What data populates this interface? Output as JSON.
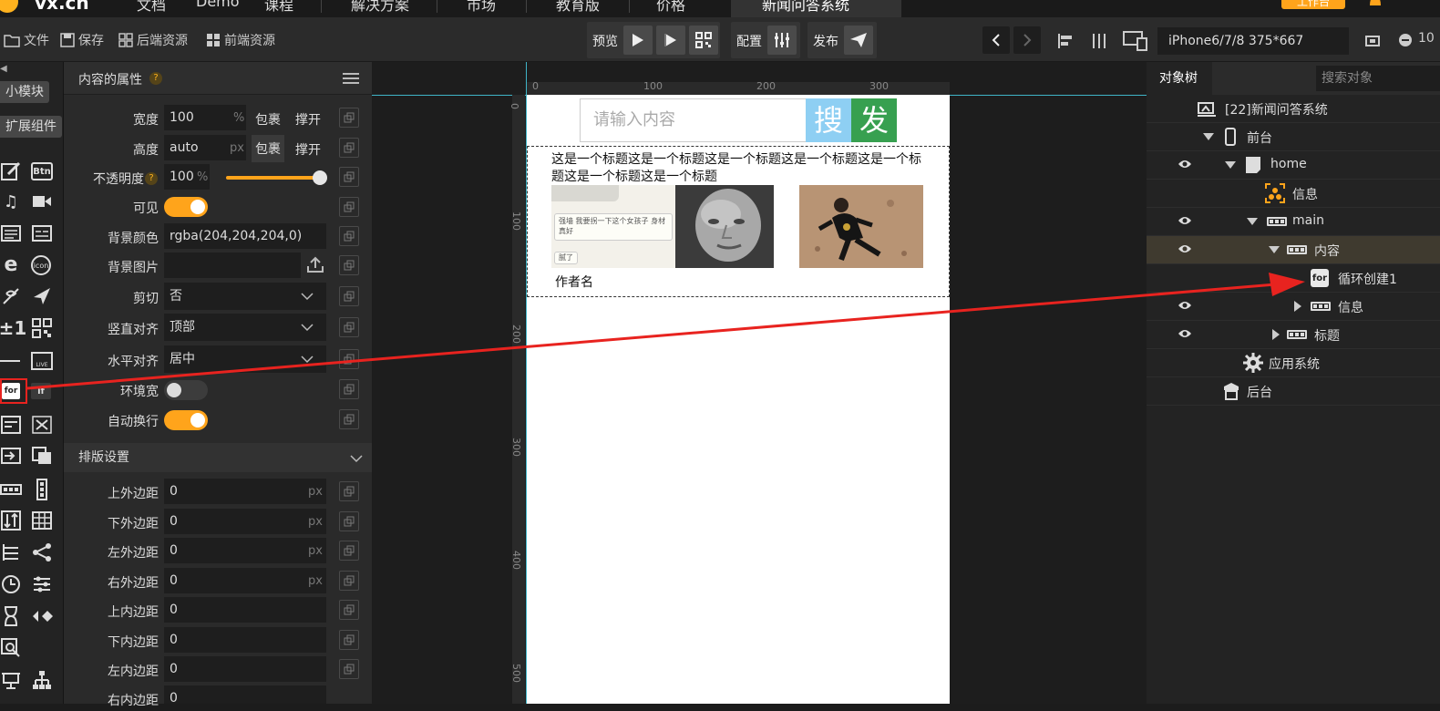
{
  "topnav": {
    "logo": "vx.cn",
    "items": [
      "文档",
      "Demo",
      "课程",
      "解决方案",
      "市场",
      "教育版",
      "价格"
    ],
    "active_tab": "新闻问答系统",
    "workbench_label": "工作台"
  },
  "toolbar": {
    "file": "文件",
    "save": "保存",
    "backend_assets": "后端资源",
    "frontend_assets": "前端资源",
    "preview": "预览",
    "config": "配置",
    "publish": "发布",
    "device": "iPhone6/7/8 375*667",
    "zoom": "10"
  },
  "rail": {
    "tag_small_module": "小模块",
    "tag_extension": "扩展组件",
    "btn_chip": "Btn",
    "icon_chip": "icon",
    "live_chip": "LIVE",
    "for_chip": "for",
    "if_chip": "if",
    "plus_minus": "±1"
  },
  "props": {
    "title": "内容的属性",
    "width_label": "宽度",
    "width_value": "100",
    "width_unit": "%",
    "width_wrap": "包裹",
    "width_fill": "撑开",
    "height_label": "高度",
    "height_value": "auto",
    "height_unit": "px",
    "height_wrap": "包裹",
    "height_fill": "撑开",
    "opacity_label": "不透明度",
    "opacity_value": "100",
    "opacity_unit": "%",
    "opacity_level": 1.0,
    "visible_label": "可见",
    "bgcolor_label": "背景颜色",
    "bgcolor_value": "rgba(204,204,204,0)",
    "bgimage_label": "背景图片",
    "clip_label": "剪切",
    "clip_value": "否",
    "valign_label": "竖直对齐",
    "valign_value": "顶部",
    "halign_label": "水平对齐",
    "halign_value": "居中",
    "envwidth_label": "环境宽",
    "autowrap_label": "自动换行",
    "layout_section": "排版设置",
    "margin_top_label": "上外边距",
    "margin_top_value": "0",
    "margin_bottom_label": "下外边距",
    "margin_bottom_value": "0",
    "margin_left_label": "左外边距",
    "margin_left_value": "0",
    "margin_right_label": "右外边距",
    "margin_right_value": "0",
    "padding_top_label": "上内边距",
    "padding_top_value": "0",
    "padding_bottom_label": "下内边距",
    "padding_bottom_value": "0",
    "padding_left_label": "左内边距",
    "padding_left_value": "0",
    "padding_right_label": "右内边距",
    "padding_right_value": "0",
    "px": "px"
  },
  "canvas": {
    "ruler_top": [
      "0",
      "100",
      "200",
      "300"
    ],
    "ruler_left": [
      "0",
      "100",
      "200",
      "300",
      "400",
      "500"
    ],
    "search_placeholder": "请输入内容",
    "btn_search": "搜",
    "btn_send": "发",
    "title_text": "这是一个标题这是一个标题这是一个标题这是一个标题这是一个标题这是一个标题这是一个标题",
    "chat_line1": "强墙 我要拐一下这个女孩子 身材真好",
    "chat_line2": "腻了",
    "author": "作者名"
  },
  "tree": {
    "tab_object_tree": "对象树",
    "search_placeholder": "搜索对象",
    "rows": [
      {
        "label": "[22]新闻问答系统"
      },
      {
        "label": "前台"
      },
      {
        "label": "home"
      },
      {
        "label": "信息"
      },
      {
        "label": "main"
      },
      {
        "label": "内容"
      },
      {
        "label": "循环创建1",
        "chip": "for"
      },
      {
        "label": "信息"
      },
      {
        "label": "标题"
      },
      {
        "label": "应用系统"
      },
      {
        "label": "后台"
      }
    ]
  },
  "colors": {
    "accent": "#ffa41b",
    "arrow": "#e8231f",
    "search_btn": "#8ecff3",
    "send_btn": "#37a050"
  }
}
